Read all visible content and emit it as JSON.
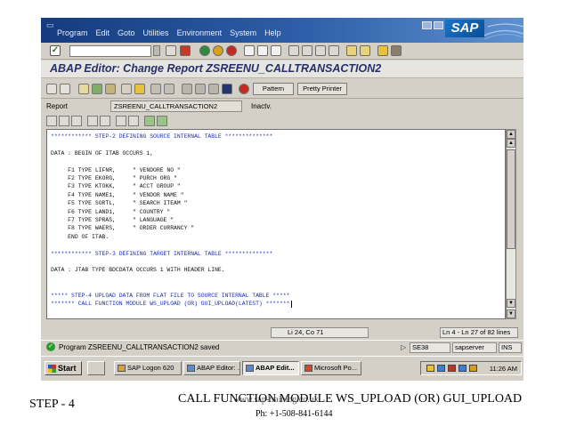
{
  "menu": {
    "items": [
      "Program",
      "Edit",
      "Goto",
      "Utilities",
      "Environment",
      "System",
      "Help"
    ],
    "logo": "SAP"
  },
  "screen_title": "ABAP Editor: Change Report ZSREENU_CALLTRANSACTION2",
  "app_toolbar": {
    "pattern_label": "Pattern",
    "pretty_printer_label": "Pretty Printer"
  },
  "report": {
    "label": "Report",
    "name": "ZSREENU_CALLTRANSACTION2",
    "state": "Inactv."
  },
  "editor": {
    "lines": [
      {
        "text": "************ STEP-2 DEFINING SOURCE INTERNAL TABLE **************",
        "color": "blue"
      },
      {
        "text": "",
        "color": "black"
      },
      {
        "text": "DATA : BEGIN OF ITAB OCCURS 1,",
        "color": "black"
      },
      {
        "text": "",
        "color": "black"
      },
      {
        "text": "     F1 TYPE LIFNR,     \" VENDORE NO \"",
        "color": "black"
      },
      {
        "text": "     F2 TYPE EKORG,     \" PURCH ORG \"",
        "color": "black"
      },
      {
        "text": "     F3 TYPE KTOKK,     \" ACCT GROUP \"",
        "color": "black"
      },
      {
        "text": "     F4 TYPE NAME1,     \" VENDOR NAME \"",
        "color": "black"
      },
      {
        "text": "     F5 TYPE SORTL,     \" SEARCH ITEAM \"",
        "color": "black"
      },
      {
        "text": "     F6 TYPE LAND1,     \" COUNTRY \"",
        "color": "black"
      },
      {
        "text": "     F7 TYPE SPRAS,     \" LANGUAGE \"",
        "color": "black"
      },
      {
        "text": "     F8 TYPE WAERS,     \" ORDER CURRANCY \"",
        "color": "black"
      },
      {
        "text": "     END OF ITAB.",
        "color": "black"
      },
      {
        "text": "",
        "color": "black"
      },
      {
        "text": "************ STEP-3 DEFINING TARGET INTERNAL TABLE **************",
        "color": "blue"
      },
      {
        "text": "",
        "color": "black"
      },
      {
        "text": "DATA : JTAB TYPE BDCDATA OCCURS 1 WITH HEADER LINE.",
        "color": "black"
      },
      {
        "text": "",
        "color": "black"
      },
      {
        "text": "",
        "color": "black"
      },
      {
        "text": "***** STEP-4 UPLOAD DATA FROM FLAT FILE TO SOURCE INTERNAL TABLE *****",
        "color": "blue"
      },
      {
        "text": "******* CALL FUNCTION MODULE WS_UPLOAD (OR) GUI_UPLOAD(LATEST) *******",
        "color": "blue"
      }
    ]
  },
  "cursor_position": "Li 24, Co 71",
  "line_info": "Ln 4 - Ln 27 of 82 lines",
  "status": {
    "message": "Program ZSREENU_CALLTRANSACTION2 saved",
    "system": "SE38",
    "host": "sapserver",
    "mode": "INS"
  },
  "taskbar": {
    "start_label": "Start",
    "tasks": [
      {
        "label": "SAP Logon 620",
        "active": false
      },
      {
        "label": "ABAP Editor: ...",
        "active": false
      },
      {
        "label": "ABAP Edit...",
        "active": true
      },
      {
        "label": "Microsoft Po...",
        "active": false
      }
    ],
    "clock": "11:26 AM"
  },
  "slide": {
    "step": "STEP - 4",
    "caption": "CALL FUNCTION MODULE WS_UPLOAD (OR) GUI_UPLOAD",
    "watermark": "www.sap-training.co.uk",
    "phone": "Ph: +1-508-841-6144"
  }
}
